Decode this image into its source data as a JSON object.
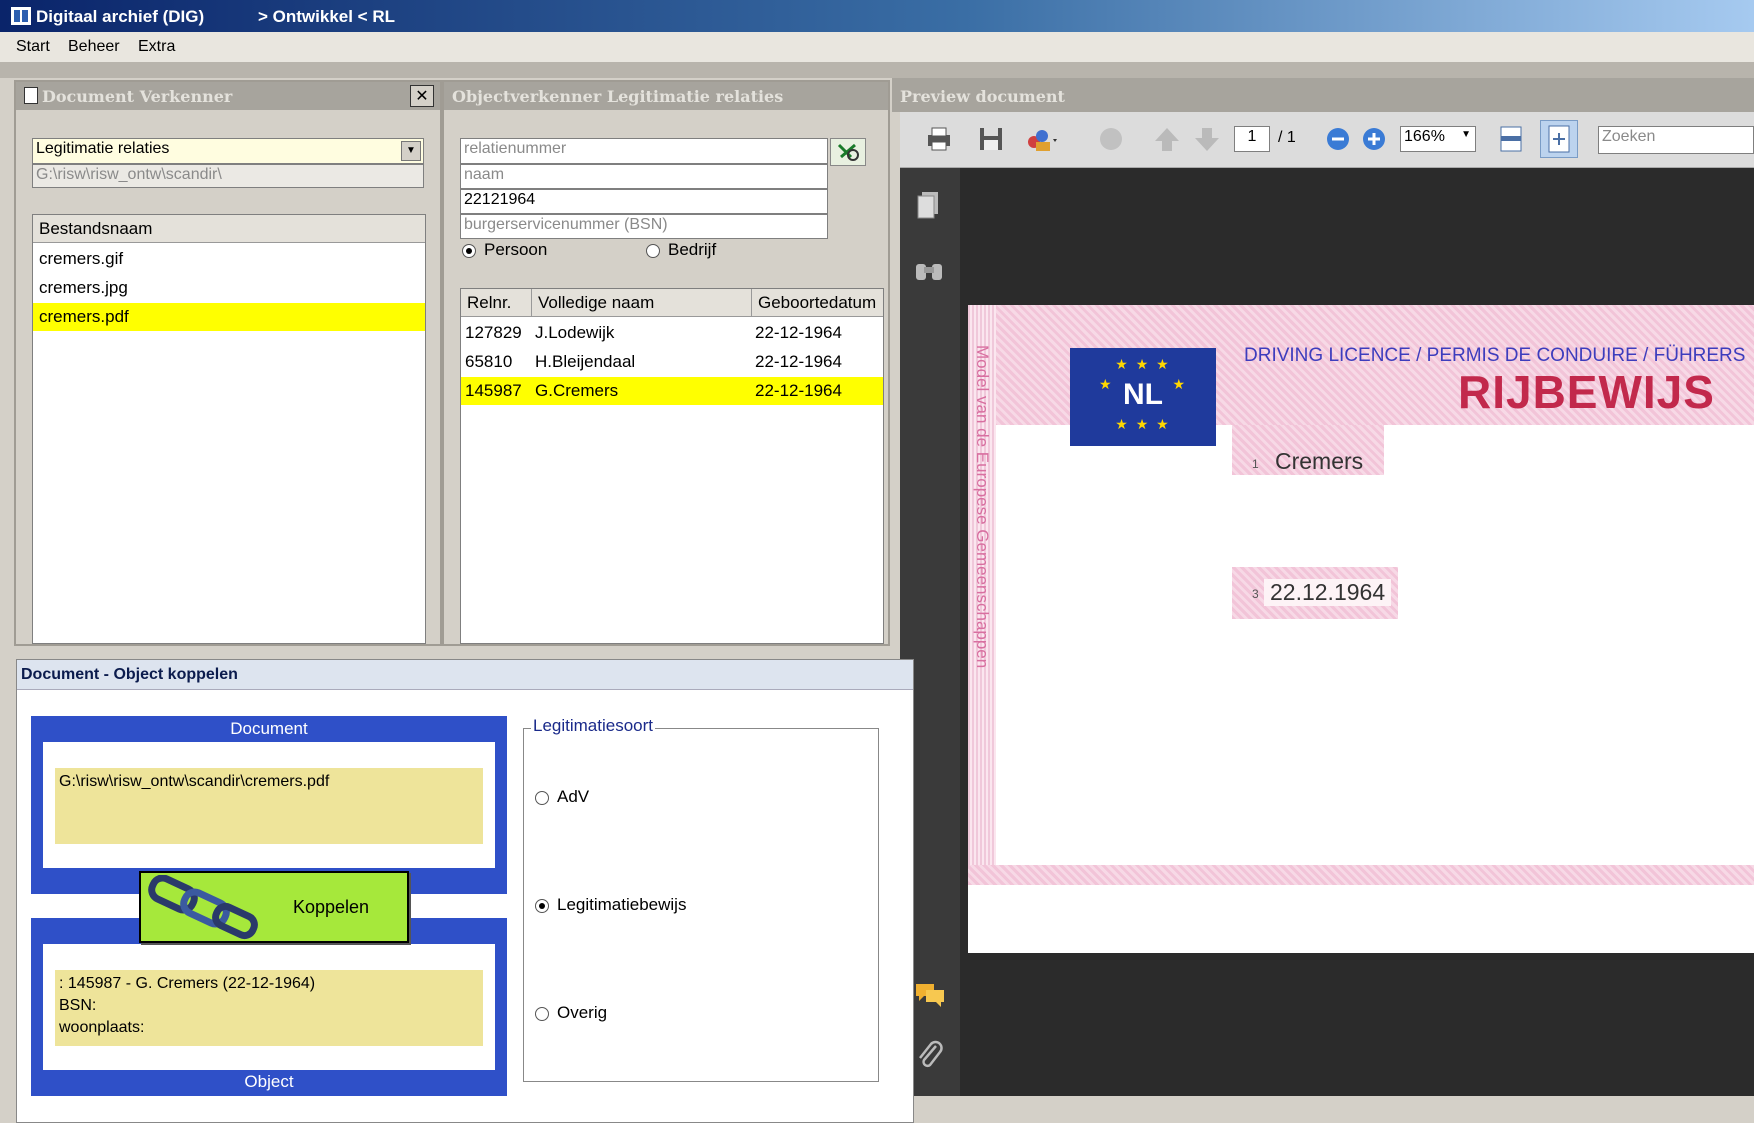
{
  "window": {
    "app_title": "Digitaal archief (DIG)",
    "context": "> Ontwikkel < RL"
  },
  "menu": [
    "Start",
    "Beheer",
    "Extra"
  ],
  "doc_explorer": {
    "title": "Document Verkenner",
    "category": "Legitimatie relaties",
    "path": "G:\\risw\\risw_ontw\\scandir\\",
    "column": "Bestandsnaam",
    "files": [
      "cremers.gif",
      "cremers.jpg",
      "cremers.pdf"
    ],
    "selected_index": 2
  },
  "obj_explorer": {
    "title": "Objectverkenner Legitimatie relaties",
    "fields": {
      "relatienummer_placeholder": "relatienummer",
      "naam_placeholder": "naam",
      "date_value": "22121964",
      "bsn_placeholder": "burgerservicenummer (BSN)"
    },
    "radios": [
      {
        "label": "Persoon",
        "checked": true
      },
      {
        "label": "Bedrijf",
        "checked": false
      }
    ],
    "columns": [
      "Relnr.",
      "Volledige naam",
      "Geboortedatum"
    ],
    "rows": [
      {
        "relnr": "127829",
        "name": "J.Lodewijk",
        "dob": "22-12-1964"
      },
      {
        "relnr": "65810",
        "name": "H.Bleijendaal",
        "dob": "22-12-1964"
      },
      {
        "relnr": "145987",
        "name": "G.Cremers",
        "dob": "22-12-1964"
      }
    ],
    "selected_index": 2
  },
  "preview": {
    "title": "Preview document",
    "page": "1",
    "page_total": "/ 1",
    "zoom": "166%",
    "search_placeholder": "Zoeken",
    "license": {
      "country": "NL",
      "subtitle": "DRIVING LICENCE / PERMIS DE CONDUIRE / FÜHRERS",
      "title": "RIJBEWIJS",
      "name_prefix": "1",
      "name": "Cremers",
      "date_prefix": "3",
      "date": "22.12.1964",
      "vertical_text": "Model van de Europese Gemeenschappen"
    }
  },
  "dialog": {
    "title": "Document - Object koppelen",
    "document_label": "Document",
    "document_path": "G:\\risw\\risw_ontw\\scandir\\cremers.pdf",
    "button_label": "Koppelen",
    "object_label": "Object",
    "object_lines": [
      ": 145987 - G. Cremers (22-12-1964)",
      "BSN:",
      "woonplaats:"
    ],
    "legend": "Legitimatiesoort",
    "options": [
      {
        "label": "AdV",
        "checked": false
      },
      {
        "label": "Legitimatiebewijs",
        "checked": true
      },
      {
        "label": "Overig",
        "checked": false
      }
    ]
  }
}
